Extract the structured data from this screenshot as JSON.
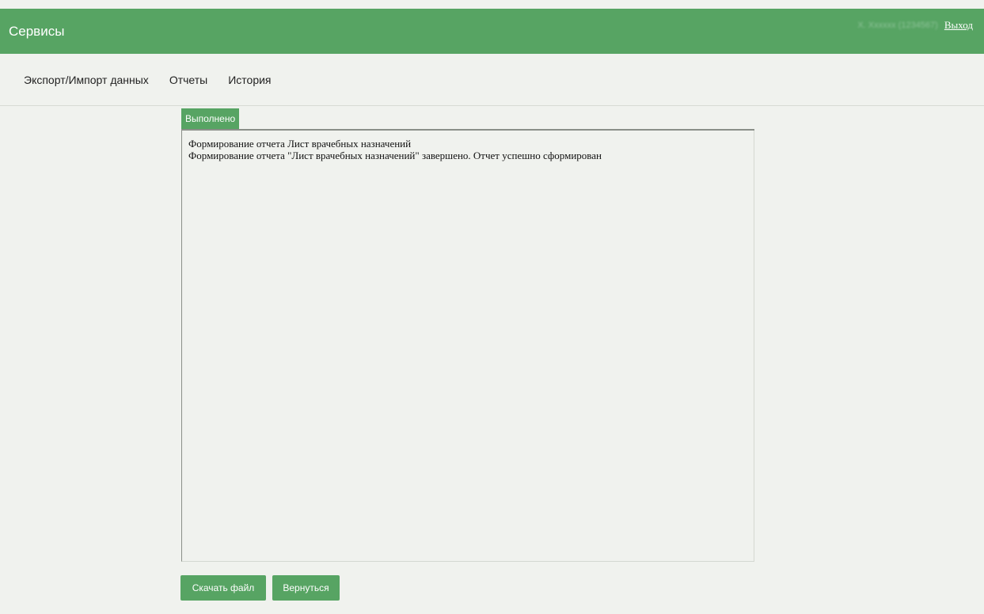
{
  "header": {
    "title": "Сервисы",
    "user_name": "Х. Хххххх (1234567)",
    "logout_label": "Выход"
  },
  "nav": {
    "items": [
      {
        "label": "Экспорт/Импорт данных"
      },
      {
        "label": "Отчеты"
      },
      {
        "label": "История"
      }
    ]
  },
  "status_tab": {
    "label": "Выполнено"
  },
  "log": {
    "lines": [
      "Формирование отчета Лист врачебных назначений",
      "Формирование отчета \"Лист врачебных назначений\" завершено. Отчет успешно сформирован"
    ]
  },
  "buttons": {
    "download_label": "Скачать файл",
    "back_label": "Вернуться"
  },
  "colors": {
    "accent": "#57a463",
    "background": "#f0f2ee"
  }
}
